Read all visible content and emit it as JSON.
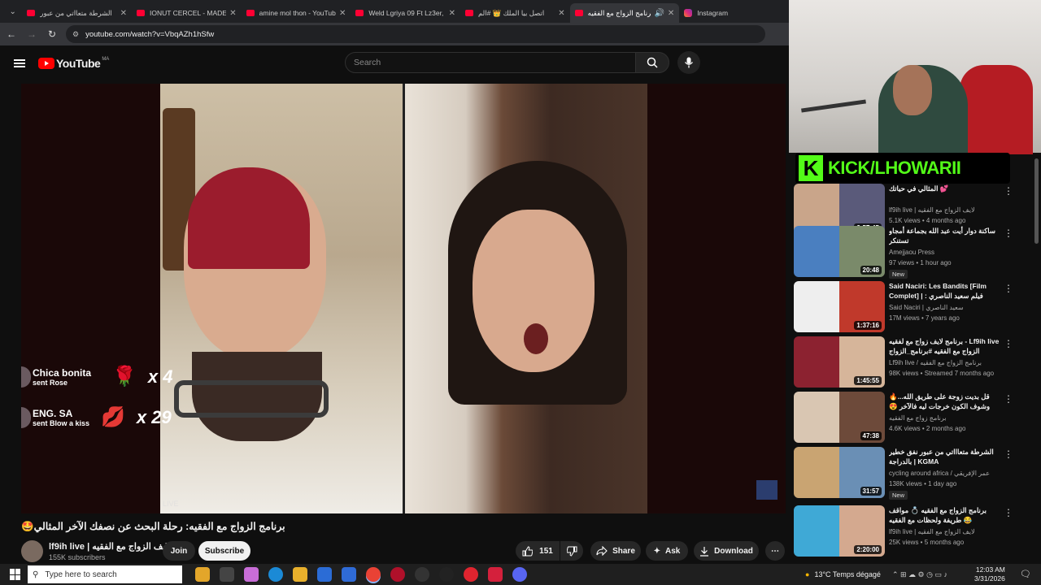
{
  "tabs": [
    {
      "title": "الشرطة متعااتي من عبور",
      "active": false
    },
    {
      "title": "IONUT CERCEL - MADE IN",
      "active": false
    },
    {
      "title": "amine mol thon - YouTub",
      "active": false
    },
    {
      "title": "Weld Lgriya 09 Ft Lz3er, C",
      "active": false
    },
    {
      "title": "اتصل بيا الملك 👑 #الم",
      "active": false
    },
    {
      "title": "برنامج الزواج مع الفقيه",
      "active": true
    },
    {
      "title": "Instagram",
      "active": false
    }
  ],
  "browser": {
    "url": "youtube.com/watch?v=VbqAZh1hSfw"
  },
  "header": {
    "logo_text": "YouTube",
    "country_code": "MA",
    "search_placeholder": "Search"
  },
  "player": {
    "gifts": [
      {
        "name": "Chica bonita",
        "action": "sent Rose",
        "icon": "🌹",
        "multiplier": "x 4"
      },
      {
        "name": "ENG. SA",
        "action": "sent Blow a kiss",
        "icon": "💋",
        "multiplier": "x 29"
      }
    ],
    "live_label": "LIVE"
  },
  "video": {
    "title": "برنامج الزواج مع الفقيه: رحلة البحث عن نصفك الآخر المثالي🤩",
    "channel_name": "lf9ih live | لايف الزواج مع الفقيه",
    "subscribers": "155K subscribers",
    "join": "Join",
    "subscribe": "Subscribe",
    "likes": "151",
    "share": "Share",
    "ask": "Ask",
    "download": "Download"
  },
  "overlay": {
    "kick_text": "KICK/LHOWARII"
  },
  "recommendations": [
    {
      "title": "المثالي في حياتك 💕",
      "channel": "lf9ih live | لايف الزواج مع الفقيه",
      "meta": "5.1K views • 4 months ago",
      "duration": "2:57:45",
      "badge": "",
      "thumb": [
        "#c9a58a",
        "#5a5a7a"
      ]
    },
    {
      "title": "ساكنة دوار أيت عبد الله بجماعة أمجاو تستنكر",
      "channel": "Amejjaou Press",
      "meta": "97 views • 1 hour ago",
      "duration": "20:48",
      "badge": "New",
      "thumb": [
        "#4a7fc0",
        "#7a8a6a"
      ]
    },
    {
      "title": "Said Naciri: Les Bandits [Film Complet] | فيلم سعيد الناصري : البانضية",
      "channel": "Said Naciri | سعيد الناصري",
      "meta": "17M views • 7 years ago",
      "duration": "1:37:16",
      "badge": "",
      "thumb": [
        "#eeeeee",
        "#c0392b"
      ]
    },
    {
      "title": "برنامج لايف زواج مع لفقيه - Lf9ih live الزواج مع الفقيه #برنامج_الزواج",
      "channel": "Lf9ih live / برنامج الزواج مع الفقيه",
      "meta": "98K views • Streamed 7 months ago",
      "duration": "1:45:55",
      "badge": "",
      "thumb": [
        "#8c2230",
        "#d6b59a"
      ]
    },
    {
      "title": "🔥قل بديت زوجة على طريق الله... وشوف الكون خرجات ليه فالآخر 😍 #برنامج زواج",
      "channel": "برنامج زواج مع الفقيه",
      "meta": "4.6K views • 2 months ago",
      "duration": "47:38",
      "badge": "",
      "thumb": [
        "#d9c6b2",
        "#6d4a3a"
      ]
    },
    {
      "title": "الشرطة متعاااتي من عبور نفق خطير بالدراجة | KGMA",
      "channel": "cycling around africa / عمر الإفريقي",
      "meta": "138K views • 1 day ago",
      "duration": "31:57",
      "badge": "New",
      "thumb": [
        "#c9a472",
        "#6a8fb5"
      ]
    },
    {
      "title": "برنامج الزواج مع الفقيه 💍 مواقف طريفة ولحظات مع الفقيه 😂",
      "channel": "lf9ih live | لايف الزواج مع الفقيه",
      "meta": "25K views • 5 months ago",
      "duration": "2:20:00",
      "badge": "",
      "thumb": [
        "#3fa9d6",
        "#d4a98f"
      ]
    }
  ],
  "taskbar": {
    "search_placeholder": "Type here to search",
    "weather": "13°C  Temps dégagé",
    "time": "12:03 AM",
    "date": "3/31/2026"
  }
}
